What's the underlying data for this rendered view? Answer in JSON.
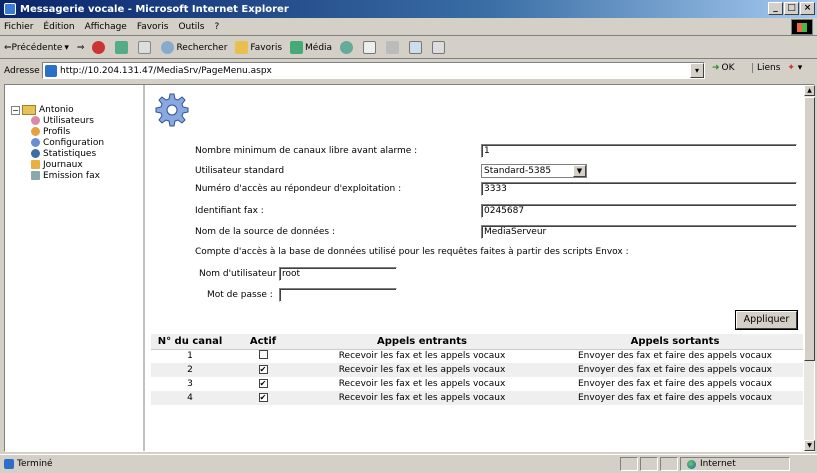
{
  "window": {
    "title": "Messagerie vocale - Microsoft Internet Explorer"
  },
  "menu": {
    "items": [
      "Fichier",
      "Édition",
      "Affichage",
      "Favoris",
      "Outils",
      "?"
    ]
  },
  "toolbar": {
    "back": "Précédente",
    "search": "Rechercher",
    "favorites": "Favoris",
    "media": "Média"
  },
  "address": {
    "label": "Adresse",
    "url": "http://10.204.131.47/MediaSrv/PageMenu.aspx",
    "go": "OK",
    "links": "Liens"
  },
  "tree": {
    "root": "Antonio",
    "items": [
      "Utilisateurs",
      "Profils",
      "Configuration",
      "Statistiques",
      "Journaux",
      "Emission fax"
    ]
  },
  "form": {
    "min_channels_label": "Nombre minimum de canaux libre avant alarme :",
    "min_channels_value": "1",
    "standard_user_label": "Utilisateur standard",
    "standard_user_value": "Standard-5385",
    "access_number_label": "Numéro d'accès au répondeur d'exploitation :",
    "access_number_value": "3333",
    "fax_id_label": "Identifiant fax :",
    "fax_id_value": "0245687",
    "datasource_label": "Nom de la source de données :",
    "datasource_value": "MediaServeur",
    "db_account_label": "Compte d'accès à la base de données utilisé pour les requêtes faites à partir des scripts Envox :",
    "username_label": "Nom d'utilisateur",
    "username_value": "root",
    "password_label": "Mot de passe :",
    "password_value": "",
    "apply_label": "Appliquer"
  },
  "table": {
    "headers": [
      "N° du canal",
      "Actif",
      "Appels entrants",
      "Appels sortants"
    ],
    "rows": [
      {
        "channel": "1",
        "active": false,
        "incoming": "Recevoir les fax et les appels vocaux",
        "outgoing": "Envoyer des fax et faire des appels vocaux"
      },
      {
        "channel": "2",
        "active": true,
        "incoming": "Recevoir les fax et les appels vocaux",
        "outgoing": "Envoyer des fax et faire des appels vocaux"
      },
      {
        "channel": "3",
        "active": true,
        "incoming": "Recevoir les fax et les appels vocaux",
        "outgoing": "Envoyer des fax et faire des appels vocaux"
      },
      {
        "channel": "4",
        "active": true,
        "incoming": "Recevoir les fax et les appels vocaux",
        "outgoing": "Envoyer des fax et faire des appels vocaux"
      }
    ]
  },
  "status": {
    "text": "Terminé",
    "zone": "Internet"
  },
  "colors": {
    "titlebar": "#0a246a",
    "chrome": "#d4d0c8",
    "row_alt": "#efefef"
  }
}
